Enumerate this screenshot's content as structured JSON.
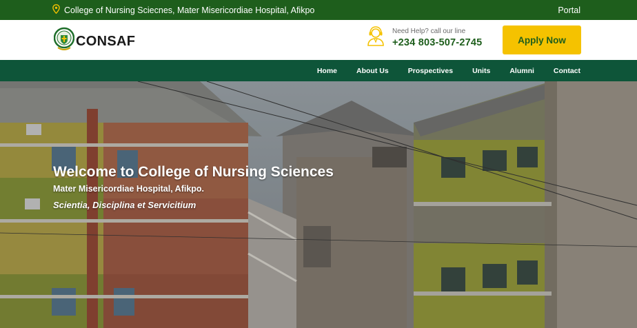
{
  "topbar": {
    "location": "College of Nursing Sciecnes, Mater Misericordiae Hospital, Afikpo",
    "portal": "Portal"
  },
  "header": {
    "logo_text": "CONSAF",
    "help_label": "Need Help? call our line",
    "phone": "+234 803-507-2745",
    "apply": "Apply Now"
  },
  "nav": {
    "items": [
      "Home",
      "About Us",
      "Prospectives",
      "Units",
      "Alumni",
      "Contact"
    ]
  },
  "hero": {
    "title": "Welcome to College of Nursing Sciences",
    "subtitle": "Mater Misericordiae Hospital, Afikpo.",
    "motto": "Scientia, Disciplina et Servicitium"
  },
  "colors": {
    "topbar": "#1e5e1c",
    "nav": "#0e5539",
    "accent": "#f5c200",
    "brand_green": "#1e5e1c"
  }
}
